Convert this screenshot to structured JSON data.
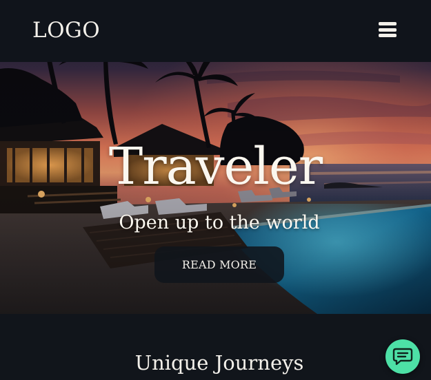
{
  "header": {
    "logo_text": "LOGO",
    "menu_icon": "hamburger-menu-icon"
  },
  "hero": {
    "title": "Traveler",
    "subtitle": "Open up to the world",
    "cta_label": "READ MORE",
    "background_image": "tropical beach resort at sunset with palm trees, thatched villas, loungers and infinity pool"
  },
  "section": {
    "title": "Unique Journeys"
  },
  "chat": {
    "icon": "chat-bubble-icon"
  },
  "colors": {
    "page_background": "#11151b",
    "header_background": "#10141b",
    "text_light": "#f3f0ea",
    "chat_accent": "#4de0a6",
    "button_background": "#10141b"
  }
}
